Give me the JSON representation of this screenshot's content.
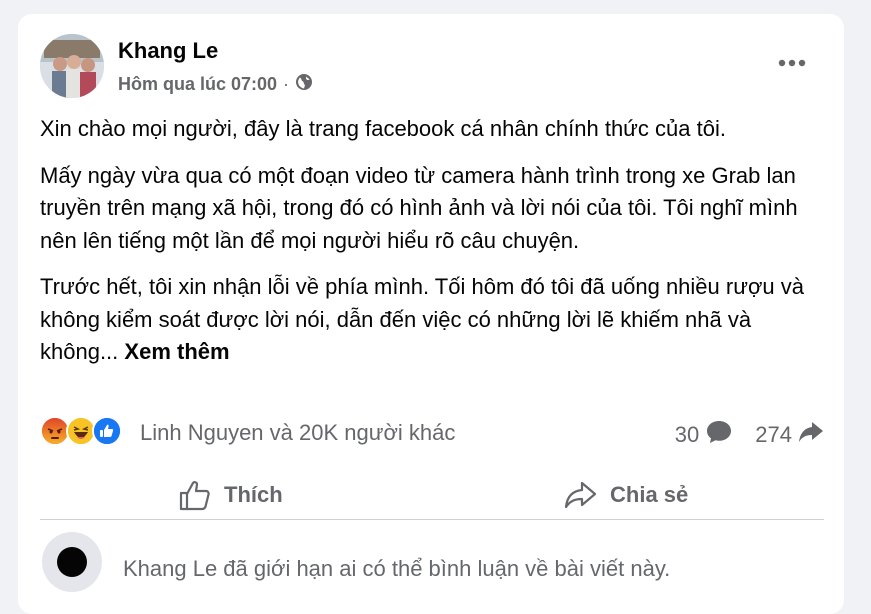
{
  "post": {
    "author": "Khang Le",
    "timestamp": "Hôm qua lúc 07:00",
    "separator": "·",
    "privacy_icon": "globe-icon",
    "more_icon": "more-horizontal-icon",
    "paragraphs": [
      "Xin chào mọi người, đây là trang facebook cá nhân chính thức của tôi.",
      "Mấy ngày vừa qua có một đoạn video từ camera hành trình trong xe Grab lan truyền trên mạng xã hội, trong đó có hình ảnh và lời nói của tôi. Tôi nghĩ mình nên lên tiếng một lần để mọi người hiểu rõ câu chuyện.",
      "Trước hết, tôi xin nhận lỗi về phía mình. Tối hôm đó tôi đã uống nhiều rượu và không kiểm soát được lời nói, dẫn đến việc có những lời lẽ khiếm nhã và không..."
    ],
    "see_more": "Xem thêm"
  },
  "reactions": {
    "icons": [
      "angry-reaction-icon",
      "haha-reaction-icon",
      "like-reaction-icon"
    ],
    "summary": "Linh Nguyen và 20K người khác",
    "comment_count": "30",
    "share_count": "274"
  },
  "actions": {
    "like_label": "Thích",
    "share_label": "Chia sẻ"
  },
  "composer": {
    "restricted_text": "Khang Le đã giới hạn ai có thể bình luận về bài viết này."
  },
  "colors": {
    "background": "#f0f2f5",
    "card": "#ffffff",
    "primary_text": "#050505",
    "secondary_text": "#65676b",
    "like_blue": "#1877f2",
    "angry_red": "#e9710f",
    "haha_yellow": "#f7b125"
  }
}
